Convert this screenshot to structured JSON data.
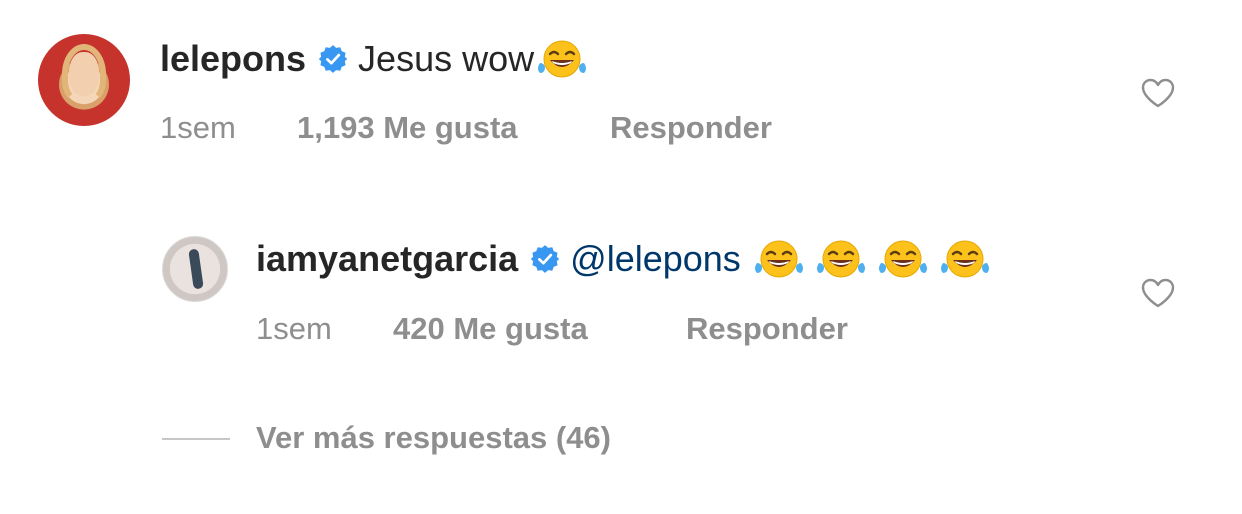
{
  "comment": {
    "username": "lelepons",
    "text": "Jesus wow",
    "emoji_count": 1,
    "emoji": "face-with-tears-of-joy",
    "time": "1sem",
    "likes": "1,193 Me gusta",
    "reply": "Responder"
  },
  "reply": {
    "username": "iamyanetgarcia",
    "mention": "@lelepons",
    "emoji_count": 4,
    "emoji": "face-with-tears-of-joy",
    "time": "1sem",
    "likes": "420 Me gusta",
    "reply": "Responder"
  },
  "more_replies": "Ver más respuestas (46)",
  "colors": {
    "verified": "#3897f0",
    "mention": "#00376b",
    "meta": "#8e8e8e",
    "text": "#262626"
  }
}
